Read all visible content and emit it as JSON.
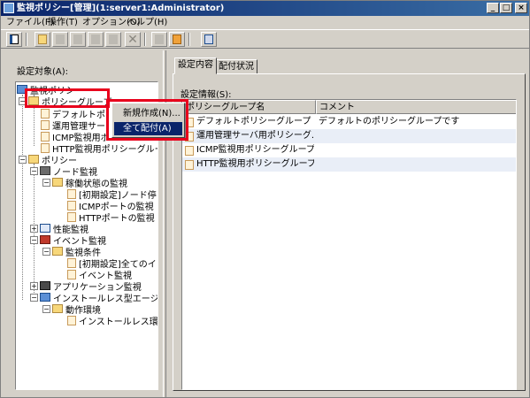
{
  "window": {
    "title": "監視ポリシー[管理](1:server1:Administrator)",
    "minimize": "_",
    "maximize": "□",
    "close": "×"
  },
  "menu": [
    {
      "label": "ファイル(F)"
    },
    {
      "label": "操作(T)"
    },
    {
      "label": "オプション(O)"
    },
    {
      "label": "ヘルプ(H)"
    }
  ],
  "toolbar": {
    "icons": [
      "properties-icon",
      "new-folder-icon",
      "new-item-icon",
      "edit-icon",
      "copy-icon",
      "paste-icon",
      "delete-icon",
      "deploy-icon",
      "deploy-all-icon",
      "refresh-icon"
    ]
  },
  "left": {
    "label": "設定対象(A):",
    "tree": {
      "root": "監視ポリシー",
      "policy_groups": "ポリシーグループ",
      "groups": [
        "デフォルトポ",
        "運用管理サー",
        "ICMP監視用ポ",
        "HTTP監視用ポリシーグルー"
      ],
      "policy": "ポリシー",
      "node_monitoring": "ノード監視",
      "status_monitoring": "稼働状態の監視",
      "status_items": [
        "[初期設定]ノード停",
        "ICMPポートの監視",
        "HTTPポートの監視"
      ],
      "performance": "性能監視",
      "event": "イベント監視",
      "monitor_condition": "監視条件",
      "event_items": [
        "[初期設定]全てのイ",
        "イベント監視"
      ],
      "application": "アプリケーション監視",
      "agentless": "インストールレス型エージ",
      "environment": "動作環境",
      "env_items": [
        "インストールレス環"
      ]
    }
  },
  "context_menu": {
    "items": [
      "新規作成(N)...",
      "全て配付(A)"
    ]
  },
  "tabs": [
    "設定内容",
    "配付状況"
  ],
  "right": {
    "info_label": "設定情報(S):",
    "columns": [
      "ポリシーグループ名",
      "コメント"
    ],
    "rows": [
      {
        "name": "デフォルトポリシーグループ",
        "comment": "デフォルトのポリシーグループです"
      },
      {
        "name": "運用管理サーバ用ポリシーグ...",
        "comment": ""
      },
      {
        "name": "ICMP監視用ポリシーグループ",
        "comment": ""
      },
      {
        "name": "HTTP監視用ポリシーグループ",
        "comment": ""
      }
    ]
  },
  "colors": {
    "highlight": "#0a246a",
    "annotation": "#e8001c"
  }
}
